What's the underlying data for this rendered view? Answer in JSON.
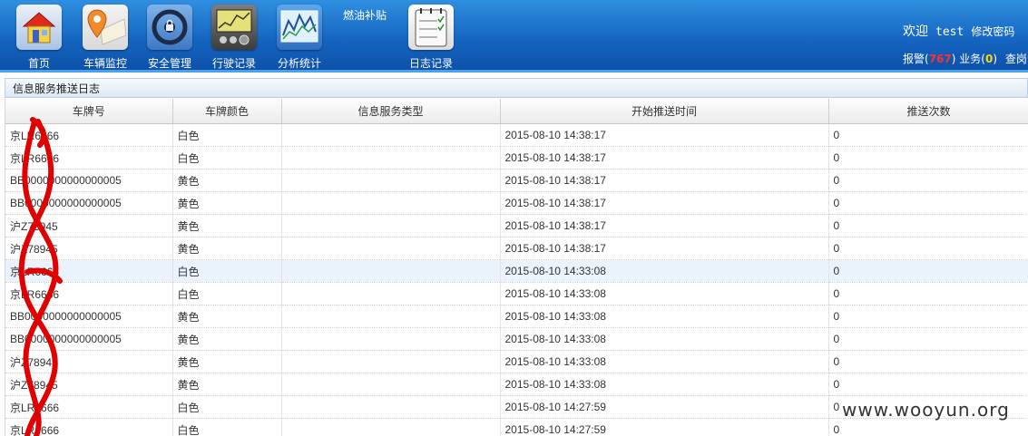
{
  "nav": {
    "items": [
      {
        "label": "首页",
        "icon": "home-icon"
      },
      {
        "label": "车辆监控",
        "icon": "map-pin-icon"
      },
      {
        "label": "安全管理",
        "icon": "steering-lock-icon"
      },
      {
        "label": "行驶记录",
        "icon": "tachograph-icon"
      },
      {
        "label": "分析统计",
        "icon": "line-chart-icon"
      },
      {
        "label": "日志记录",
        "icon": "notepad-icon"
      }
    ],
    "fuel_subsidy": "燃油补贴"
  },
  "header": {
    "welcome": "欢迎",
    "username": "test",
    "change_password": "修改密码",
    "alarm_label": "报警",
    "alarm_count": "767",
    "business_label": "业务",
    "business_count": "0",
    "query_label": "查岗"
  },
  "panel": {
    "title": "信息服务推送日志"
  },
  "table": {
    "columns": [
      "车牌号",
      "车牌颜色",
      "信息服务类型",
      "开始推送时间",
      "推送次数"
    ],
    "rows": [
      [
        "京LR6666",
        "白色",
        "",
        "2015-08-10 14:38:17",
        "0"
      ],
      [
        "京LR6666",
        "白色",
        "",
        "2015-08-10 14:38:17",
        "0"
      ],
      [
        "BB0000000000000005",
        "黄色",
        "",
        "2015-08-10 14:38:17",
        "0"
      ],
      [
        "BB0000000000000005",
        "黄色",
        "",
        "2015-08-10 14:38:17",
        "0"
      ],
      [
        "沪Z78945",
        "黄色",
        "",
        "2015-08-10 14:38:17",
        "0"
      ],
      [
        "沪Z78945",
        "黄色",
        "",
        "2015-08-10 14:38:17",
        "0"
      ],
      [
        "京LR6666",
        "白色",
        "",
        "2015-08-10 14:33:08",
        "0"
      ],
      [
        "京LR6666",
        "白色",
        "",
        "2015-08-10 14:33:08",
        "0"
      ],
      [
        "BB0000000000000005",
        "黄色",
        "",
        "2015-08-10 14:33:08",
        "0"
      ],
      [
        "BB0000000000000005",
        "黄色",
        "",
        "2015-08-10 14:33:08",
        "0"
      ],
      [
        "沪Z78945",
        "黄色",
        "",
        "2015-08-10 14:33:08",
        "0"
      ],
      [
        "沪Z78945",
        "黄色",
        "",
        "2015-08-10 14:33:08",
        "0"
      ],
      [
        "京LR6666",
        "白色",
        "",
        "2015-08-10 14:27:59",
        "0"
      ],
      [
        "京LR6666",
        "白色",
        "",
        "2015-08-10 14:27:59",
        "0"
      ]
    ],
    "selected_row": 6
  },
  "watermark": "www.wooyun.org",
  "colors": {
    "header_blue": "#1565c0",
    "alarm_red": "#ff3030",
    "business_yellow": "#ffd800",
    "redaction_red": "#e00000"
  }
}
